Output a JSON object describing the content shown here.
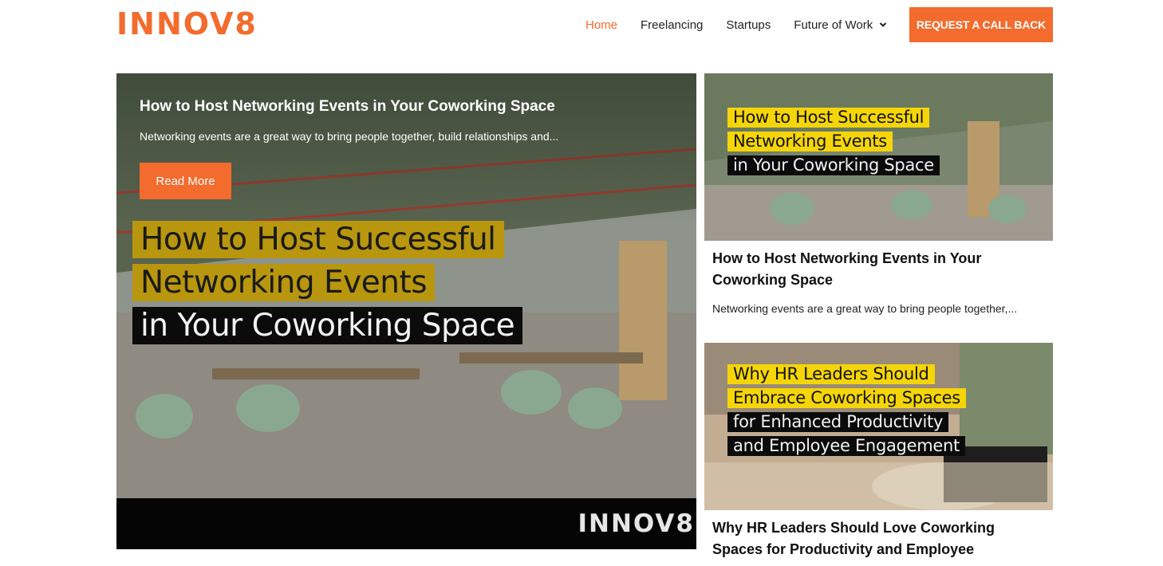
{
  "header": {
    "logo": "INNOV8",
    "nav": [
      {
        "label": "Home",
        "active": true
      },
      {
        "label": "Freelancing"
      },
      {
        "label": "Startups"
      },
      {
        "label": "Future of Work",
        "has_dropdown": true
      }
    ],
    "cta_label": "REQUEST A CALL BACK"
  },
  "hero": {
    "title": "How to Host Networking Events in Your Coworking Space",
    "excerpt": "Networking events are a great way to bring people together, build relationships and...",
    "read_more": "Read More",
    "image_text": [
      "How to Host Successful",
      "Networking Events",
      "in Your Coworking Space"
    ],
    "band_logo": "INNOV8"
  },
  "cards": [
    {
      "image_text": [
        "How to Host Successful",
        "Networking Events",
        "in Your Coworking Space"
      ],
      "title": "How to Host Networking Events in Your Coworking Space",
      "excerpt": "Networking events are a great way to bring people together,..."
    },
    {
      "image_text": [
        "Why HR Leaders Should",
        "Embrace Coworking Spaces",
        "for Enhanced Productivity",
        "and Employee Engagement"
      ],
      "title": "Why HR Leaders Should Love Coworking Spaces for Productivity and Employee"
    }
  ],
  "colors": {
    "accent": "#f36b2d",
    "gold_highlight": "#b8960e",
    "yellow_highlight": "#f5d508"
  }
}
